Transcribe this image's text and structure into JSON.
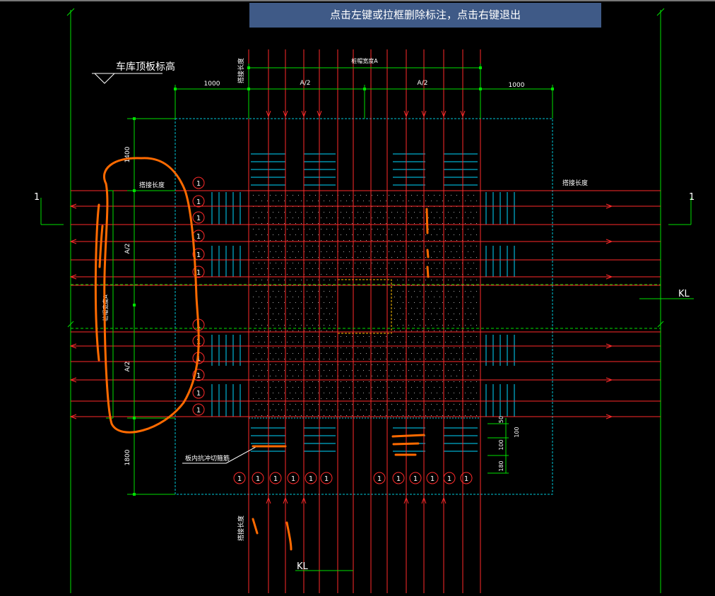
{
  "command_hint": "点击左键或拉框删除标注，点击右键退出",
  "labels": {
    "garage_roof_elev": "车库顶板标高",
    "pile_cap_width_top": "桩帽宽度A",
    "pile_cap_width_left": "桩帽宽度A",
    "half_a": "A/2",
    "dim_1000": "1000",
    "dim_1800": "1800",
    "dim_1400": "1400",
    "dim_50": "50",
    "dim_100": "100",
    "dim_180": "180",
    "anchor_len": "搭接长度",
    "punch_rebar": "板内抗冲切箍筋",
    "section_mark": "1",
    "kl": "KL",
    "rebar_tag": "1"
  },
  "colors": {
    "background": "#000000",
    "rebar": "#ff2a2a",
    "dim_line": "#00e000",
    "stirrup": "#00d8ff",
    "annotation_marker": "#ff6a00",
    "banner": "#3f5a87",
    "text": "#ffffff"
  }
}
